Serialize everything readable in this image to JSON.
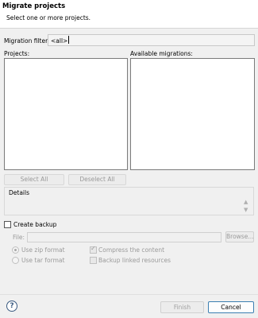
{
  "header": {
    "title": "Migrate projects",
    "subtitle": "Select one or more projects."
  },
  "filter": {
    "label": "Migration filter:",
    "value": "<all>"
  },
  "projects": {
    "label": "Projects:",
    "items": []
  },
  "migrations": {
    "label": "Available migrations:",
    "items": []
  },
  "selection_buttons": {
    "select_all": "Select All",
    "deselect_all": "Deselect All"
  },
  "details": {
    "label": "Details"
  },
  "backup": {
    "create_label": "Create backup",
    "file_label": "File:",
    "file_value": "",
    "browse_label": "Browse...",
    "zip_label": "Use zip format",
    "tar_label": "Use tar format",
    "compress_label": "Compress the content",
    "linked_label": "Backup linked resources"
  },
  "footer": {
    "finish_label": "Finish",
    "cancel_label": "Cancel"
  }
}
